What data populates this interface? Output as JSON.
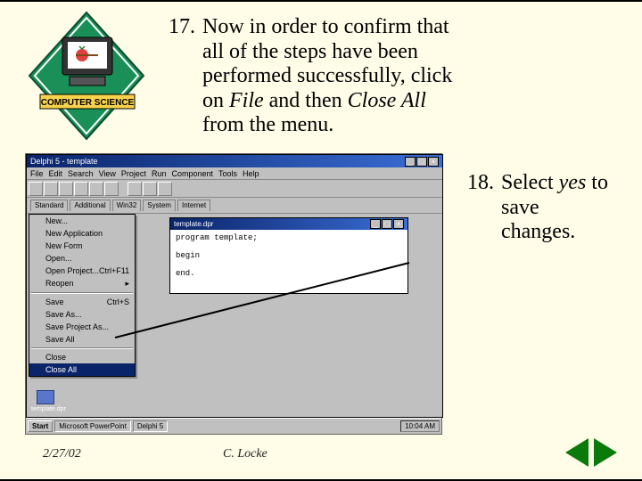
{
  "logo": {
    "banner_text": "COMPUTER SCIENCE"
  },
  "step17": {
    "number": "17.",
    "t1": "Now in order to confirm that all of the steps have been performed successfully, click on ",
    "file": "File",
    "t2": " and then ",
    "closeall": "Close All",
    "t3": " from the menu."
  },
  "step18": {
    "number": "18.",
    "t1": "Select ",
    "yes": "yes",
    "t2": " to save changes."
  },
  "footer": {
    "date": "2/27/02",
    "author": "C. Locke"
  },
  "screenshot": {
    "window_title": "Delphi 5 - template",
    "menubar": [
      "File",
      "Edit",
      "Search",
      "View",
      "Project",
      "Run",
      "Component",
      "Tools",
      "Help"
    ],
    "tabs": [
      "Standard",
      "Additional",
      "Win32",
      "System",
      "Internet"
    ],
    "file_menu": {
      "items": [
        {
          "label": "New..."
        },
        {
          "label": "New Application"
        },
        {
          "label": "New Form"
        },
        {
          "label": "Open..."
        },
        {
          "label": "Open Project...",
          "accel": "Ctrl+F11"
        },
        {
          "label": "Reopen",
          "sub": true
        }
      ],
      "sep1": true,
      "items2": [
        {
          "label": "Save",
          "accel": "Ctrl+S"
        },
        {
          "label": "Save As..."
        },
        {
          "label": "Save Project As..."
        },
        {
          "label": "Save All"
        }
      ],
      "sep2": true,
      "items3": [
        {
          "label": "Close"
        }
      ],
      "highlighted": {
        "label": "Close All"
      }
    },
    "code_window": {
      "title": "template.dpr",
      "code": "program template;\n\nbegin\n\nend."
    },
    "desktop_icon_label": "template.dpr",
    "taskbar": {
      "start": "Start",
      "items": [
        "Microsoft PowerPoint",
        "Delphi 5"
      ],
      "clock": "10:04 AM"
    }
  }
}
